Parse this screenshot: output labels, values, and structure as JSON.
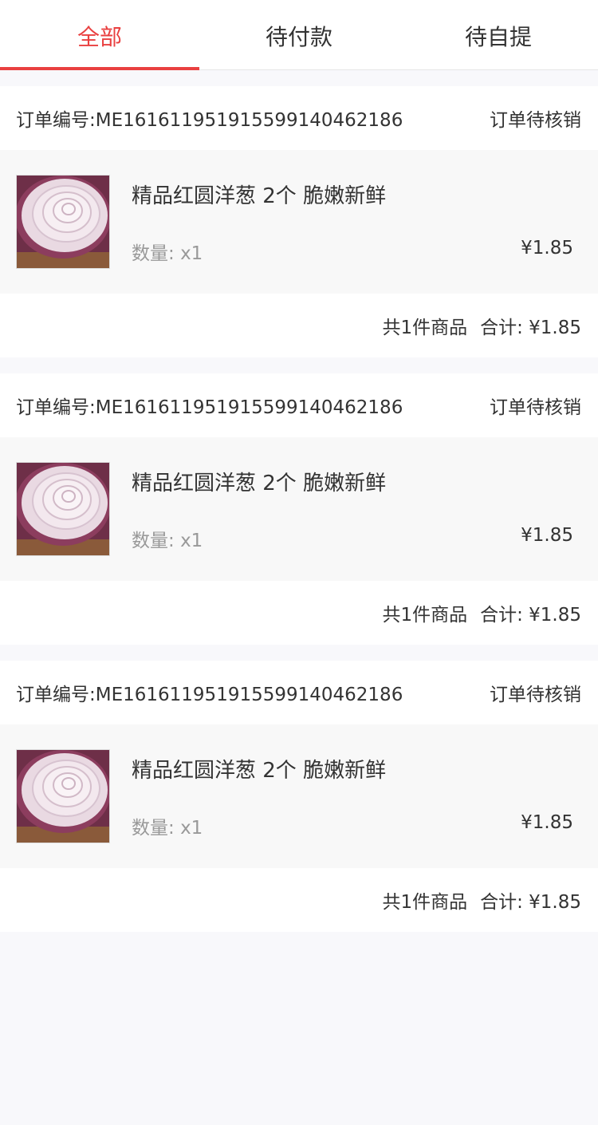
{
  "tabs": [
    {
      "label": "全部",
      "active": true
    },
    {
      "label": "待付款",
      "active": false
    },
    {
      "label": "待自提",
      "active": false
    }
  ],
  "orders": [
    {
      "order_no": "订单编号:ME161611951915599140462186",
      "status": "订单待核销",
      "item_name": "精品红圆洋葱 2个 脆嫩新鲜",
      "qty_label": "数量:",
      "qty": "x1",
      "price": "¥1.85",
      "count_text": "共1件商品",
      "total_text": "合计: ¥1.85"
    },
    {
      "order_no": "订单编号:ME161611951915599140462186",
      "status": "订单待核销",
      "item_name": "精品红圆洋葱 2个 脆嫩新鲜",
      "qty_label": "数量:",
      "qty": "x1",
      "price": "¥1.85",
      "count_text": "共1件商品",
      "total_text": "合计: ¥1.85"
    },
    {
      "order_no": "订单编号:ME161611951915599140462186",
      "status": "订单待核销",
      "item_name": "精品红圆洋葱 2个 脆嫩新鲜",
      "qty_label": "数量:",
      "qty": "x1",
      "price": "¥1.85",
      "count_text": "共1件商品",
      "total_text": "合计: ¥1.85"
    }
  ],
  "colors": {
    "accent": "#e94040",
    "text": "#333333",
    "muted": "#999999",
    "page_bg": "#f8f8fb"
  },
  "icons": {
    "product_image": "red-onion-photo"
  }
}
